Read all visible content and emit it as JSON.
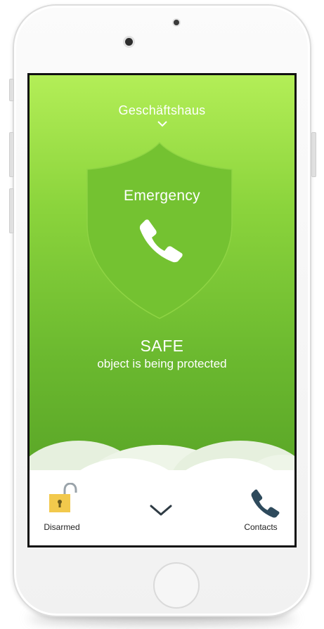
{
  "site": {
    "name": "Geschäftshaus"
  },
  "emergency": {
    "label": "Emergency"
  },
  "status": {
    "title": "SAFE",
    "subtitle": "object is being protected"
  },
  "bottom_bar": {
    "lock_label": "Disarmed",
    "contacts_label": "Contacts"
  },
  "colors": {
    "gradient_top": "#b3ee57",
    "gradient_bottom": "#4f9a22",
    "shield": "#74c231",
    "lock_icon": "#f2c94c",
    "contacts_icon": "#2e4a5c"
  },
  "icons": {
    "site_chevron": "chevron-down-icon",
    "emergency": "phone-icon",
    "lock": "unlocked-padlock-icon",
    "expand": "chevron-down-icon",
    "contacts": "phone-icon"
  }
}
